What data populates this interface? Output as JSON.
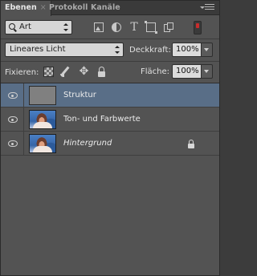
{
  "tabs": [
    {
      "label": "Ebenen",
      "active": true
    },
    {
      "label": "Protokoll",
      "active": false
    },
    {
      "label": "Kanäle",
      "active": false
    }
  ],
  "filter": {
    "kind_label": "Art",
    "icons": [
      "image-filter-icon",
      "adjustment-filter-icon",
      "type-filter-icon",
      "shape-filter-icon",
      "smart-object-filter-icon"
    ]
  },
  "blend": {
    "mode": "Lineares Licht",
    "opacity_label": "Deckkraft:",
    "opacity_value": "100%"
  },
  "locks": {
    "label": "Fixieren:",
    "fill_label": "Fläche:",
    "fill_value": "100%"
  },
  "layers": [
    {
      "name": "Struktur",
      "selected": true,
      "visible": true,
      "thumb": "gray",
      "italic": false,
      "locked": false
    },
    {
      "name": "Ton- und Farbwerte",
      "selected": false,
      "visible": true,
      "thumb": "photo",
      "italic": false,
      "locked": false
    },
    {
      "name": "Hintergrund",
      "selected": false,
      "visible": true,
      "thumb": "photo",
      "italic": true,
      "locked": true
    }
  ],
  "colors": {
    "panel_bg": "#535353",
    "selection": "#596e87",
    "filter_toggle": "#c92c2c"
  }
}
